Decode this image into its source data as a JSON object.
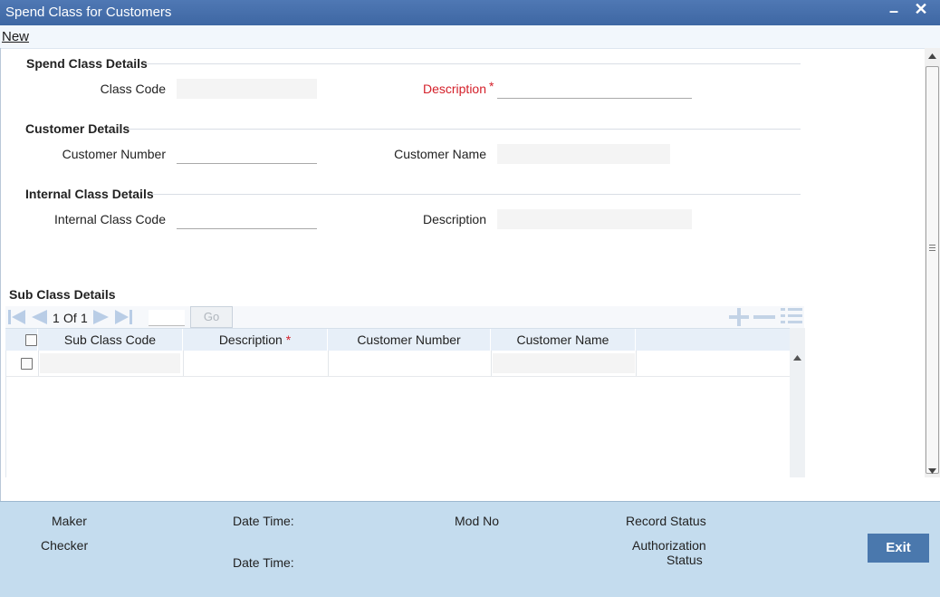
{
  "window": {
    "title": "Spend Class for Customers",
    "minimize_glyph": "–",
    "close_glyph": "✕"
  },
  "toolbar": {
    "new_label": "New"
  },
  "spend_class": {
    "section_title": "Spend Class Details",
    "class_code_label": "Class Code",
    "class_code_value": "",
    "description_label": "Description",
    "required_marker": "*",
    "description_value": ""
  },
  "customer": {
    "section_title": "Customer Details",
    "number_label": "Customer Number",
    "number_value": "",
    "name_label": "Customer Name",
    "name_value": ""
  },
  "internal_class": {
    "section_title": "Internal Class Details",
    "code_label": "Internal Class Code",
    "code_value": "",
    "description_label": "Description",
    "description_value": ""
  },
  "sub_class": {
    "section_title": "Sub Class Details",
    "pager": {
      "current": "1",
      "of_label": "Of",
      "total": "1",
      "go_label": "Go"
    },
    "columns": [
      "Sub Class Code",
      "Description",
      "Customer Number",
      "Customer Name"
    ],
    "required_marker": "*",
    "rows": [
      {
        "sub_class_code": "",
        "description": "",
        "customer_number": "",
        "customer_name": ""
      }
    ],
    "icons": [
      "first-page-icon",
      "previous-page-icon",
      "next-page-icon",
      "last-page-icon",
      "add-row-icon",
      "delete-row-icon",
      "single-view-icon"
    ]
  },
  "footer": {
    "maker_label": "Maker",
    "checker_label": "Checker",
    "date_time_label": "Date Time:",
    "mod_no_label": "Mod No",
    "record_status_label": "Record Status",
    "authorization_label": "Authorization",
    "status_label": "Status",
    "exit_label": "Exit"
  },
  "colors": {
    "title_bar": "#4670ad",
    "footer": "#c4dcee",
    "exit_button": "#4a78ad",
    "required": "#d4202a"
  }
}
